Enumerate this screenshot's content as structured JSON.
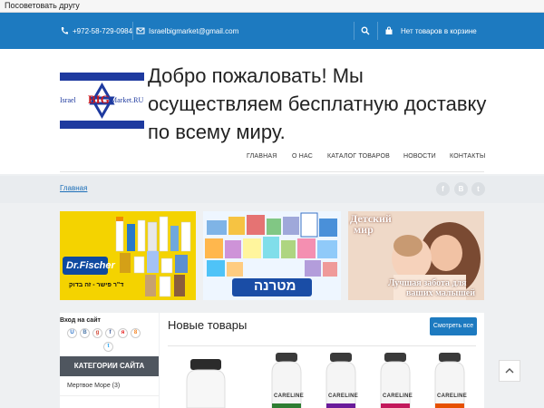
{
  "topbar": {
    "recommend": "Посоветовать другу"
  },
  "contacts": {
    "phone": "+972-58-729-0984",
    "email": "Israelbigmarket@gmail.com"
  },
  "cart": {
    "label": "Нет товаров в корзине"
  },
  "logo": {
    "left": "Israel",
    "big": "BIG",
    "right": "Market.RU"
  },
  "welcome": "Добро пожаловать! Мы осуществляем бесплатную доставку по всему миру.",
  "nav": [
    {
      "label": "ГЛАВНАЯ"
    },
    {
      "label": "О НАС"
    },
    {
      "label": "КАТАЛОГ ТОВАРОВ"
    },
    {
      "label": "НОВОСТИ"
    },
    {
      "label": "КОНТАКТЫ"
    }
  ],
  "breadcrumb": "Главная",
  "social_share": [
    "f",
    "В",
    "t"
  ],
  "banners": {
    "b1": {
      "brand": "Dr.Fischer",
      "tagline": "ד\"ר פישר - זה בדוק"
    },
    "b2": {
      "brand": "מטרנה"
    },
    "b3": {
      "title_line1": "Детский",
      "title_line2": "мир",
      "bottom_line1": "Лучшая забота для",
      "bottom_line2": "ваших малышей"
    }
  },
  "sidebar": {
    "login_title": "Вход на сайт",
    "login_icons": [
      "U",
      "В",
      "g",
      "f",
      "я",
      "8",
      "t"
    ],
    "categories_title": "КАТЕГОРИИ САЙТА",
    "categories": [
      {
        "label": "Мертвое Море (3)"
      }
    ]
  },
  "main": {
    "new_title": "Новые товары",
    "view_button": "Смотреть все",
    "product_brand": "CARELINE"
  },
  "colors": {
    "accent": "#1d7ac0",
    "dark": "#4f565f"
  }
}
